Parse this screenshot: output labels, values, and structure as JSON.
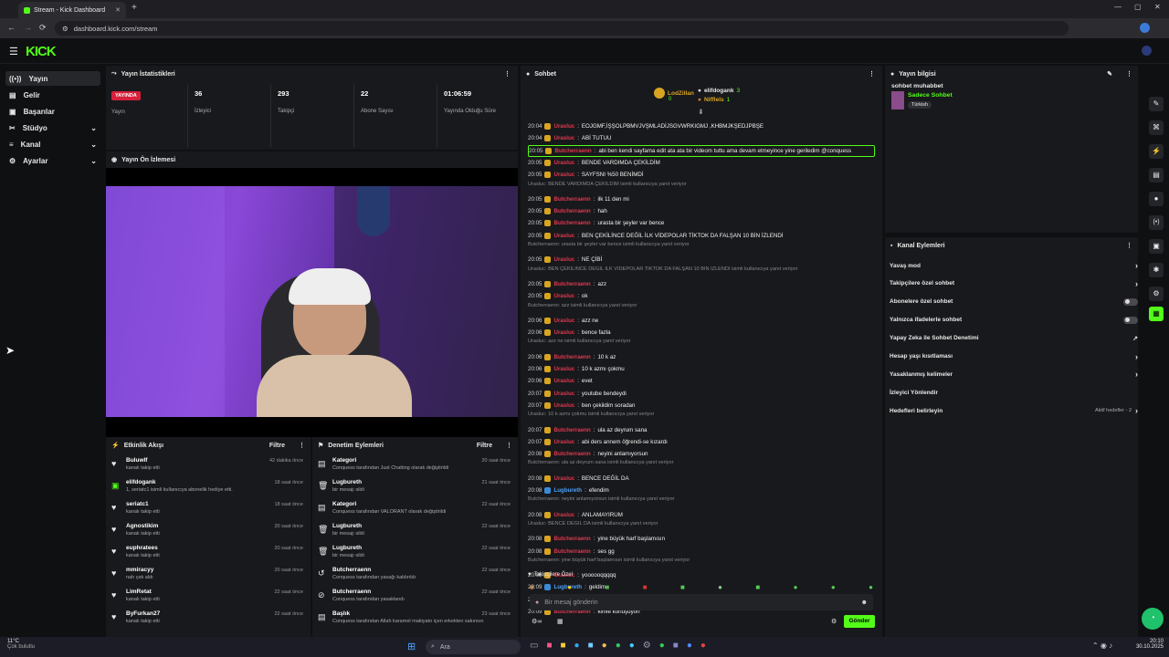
{
  "browser": {
    "tab_title": "Stream - Kick Dashboard",
    "url": "dashboard.kick.com/stream"
  },
  "brand": {
    "logo": "KICK",
    "accent": "#53fc18"
  },
  "sidebar": {
    "items": [
      {
        "label": "Yayın",
        "icon": "broadcast-icon"
      },
      {
        "label": "Gelir",
        "icon": "money-icon"
      },
      {
        "label": "Başarılar",
        "icon": "trophy-icon"
      },
      {
        "label": "Stüdyo",
        "icon": "studio-icon"
      },
      {
        "label": "Kanal",
        "icon": "channel-icon"
      },
      {
        "label": "Ayarlar",
        "icon": "gear-icon"
      }
    ]
  },
  "stats": {
    "title": "Yayın İstatistikleri",
    "live": "YAYINDA",
    "live_label": "Yayın",
    "viewers": "36",
    "viewers_label": "İzleyici",
    "followers": "293",
    "followers_label": "Takipçi",
    "subs": "22",
    "subs_label": "Abone Sayısı",
    "uptime": "01:06:59",
    "uptime_label": "Yayında Olduğu Süre"
  },
  "preview": {
    "title": "Yayın Ön İzlemesi"
  },
  "activity": {
    "title": "Etkinlik Akışı",
    "filter": "Filtre",
    "items": [
      {
        "name": "Buluwlf",
        "text": "kanalı takip etti",
        "time": "42 dakika önce"
      },
      {
        "name": "elifdogank",
        "text": "1, seriatc1 isimli kullanıcıya abonelik hediye etti.",
        "time": "18 saat önce"
      },
      {
        "name": "seriatc1",
        "text": "kanalı takip etti",
        "time": "18 saat önce"
      },
      {
        "name": "Agnostikim",
        "text": "kanalı takip etti",
        "time": "20 saat önce"
      },
      {
        "name": "euphratees",
        "text": "kanalı takip etti",
        "time": "20 saat önce"
      },
      {
        "name": "mmiracyy",
        "text": "nah çek aldı",
        "time": "20 saat önce"
      },
      {
        "name": "LimRetat",
        "text": "kanalı takip etti",
        "time": "22 saat önce"
      },
      {
        "name": "ByFurkan27",
        "text": "kanalı takip etti",
        "time": "22 saat önce"
      }
    ]
  },
  "moderation": {
    "title": "Denetim Eylemleri",
    "filter": "Filtre",
    "items": [
      {
        "name": "Kategori",
        "text": "Conquess tarafından Just Chatting olarak değiştirildi",
        "time": "20 saat önce"
      },
      {
        "name": "Lugbureth",
        "text": "bir mesajı sildi",
        "time": "21 saat önce"
      },
      {
        "name": "Kategori",
        "text": "Conquess tarafından VALORANT olarak değiştirildi",
        "time": "22 saat önce"
      },
      {
        "name": "Lugbureth",
        "text": "bir mesajı sildi",
        "time": "22 saat önce"
      },
      {
        "name": "Lugbureth",
        "text": "bir mesajı sildi",
        "time": "22 saat önce"
      },
      {
        "name": "Butcherraenn",
        "text": "Conquess tarafından yasağı kaldırıldı",
        "time": "22 saat önce"
      },
      {
        "name": "Butcherraenn",
        "text": "Conquess tarafından yasaklandı",
        "time": "22 saat önce"
      },
      {
        "name": "Başlık",
        "text": "Conquess tarafından Allah karamel makiyato içen erkekten sakınsın",
        "time": "23 saat önce"
      }
    ]
  },
  "chat": {
    "title": "Sohbet",
    "top": [
      {
        "name": "LodZillan",
        "count": "0"
      },
      {
        "name": "elifdogank",
        "count": "3"
      },
      {
        "name": "Nifflels",
        "count": "1"
      }
    ],
    "lines": [
      {
        "t": "20:04",
        "u": "Urasluc",
        "m": "EOJGMF,İŞŞOLPBMVJVŞMLADİJSGVWRKIGMJ ,KHBMJKŞEDJPBŞE"
      },
      {
        "t": "20:04",
        "u": "Urasluc",
        "m": "ABİ TUTUU"
      },
      {
        "t": "20:05",
        "u": "Butcherraenn",
        "m": "abi ben kendi sayfama edit ata ata bir videom tuttu ama devam etmeyince yine geriledim @conquess",
        "hl": true
      },
      {
        "t": "20:05",
        "u": "Urasluc",
        "m": "BENDE VARDIMDA ÇEKİLDİM"
      },
      {
        "t": "20:05",
        "u": "Urasluc",
        "m": "SAYFSNI %50 BENİMDİ"
      },
      {
        "reply": "Urasluc: BENDE VARDIMDA ÇEKİLDİM isimli kullanıcıya yanıt veriyor"
      },
      {
        "t": "20:05",
        "u": "Butcherraenn",
        "m": "ilk 11 den mi"
      },
      {
        "t": "20:05",
        "u": "Butcherraenn",
        "m": "hah"
      },
      {
        "t": "20:05",
        "u": "Butcherraenn",
        "m": "urasta bir şeyler var bence"
      },
      {
        "t": "20:05",
        "u": "Urasluc",
        "m": "BEN ÇEKİLİNCE DEĞİL İLK VİDEPOLAR TİKTOK DA FALŞAN 10 BİN İZLENDİ"
      },
      {
        "reply": "Butcherraenn: urasta bir şeyler var bence isimli kullanıcıya yanıt veriyor"
      },
      {
        "t": "20:05",
        "u": "Urasluc",
        "m": "NE ÇİBİ"
      },
      {
        "reply": "Urasluc: BEN ÇEKİLİNCE DEĞİL İLK VİDEPOLAR TİKTOK DA FALŞAN 10 BİN İZLENDİ isimli kullanıcıya yanıt veriyor"
      },
      {
        "t": "20:05",
        "u": "Butcherraenn",
        "m": "azz"
      },
      {
        "t": "20:05",
        "u": "Urasluc",
        "m": "ok"
      },
      {
        "reply": "Butcherraenn: azz isimli kullanıcıya yanıt veriyor"
      },
      {
        "t": "20:06",
        "u": "Urasluc",
        "m": "azz ne"
      },
      {
        "t": "20:06",
        "u": "Urasluc",
        "m": "bence fazla"
      },
      {
        "reply": "Urasluc: azz ne isimli kullanıcıya yanıt veriyor"
      },
      {
        "t": "20:06",
        "u": "Butcherraenn",
        "m": "10 k az"
      },
      {
        "t": "20:06",
        "u": "Urasluc",
        "m": "10 k azmı çokmu"
      },
      {
        "t": "20:06",
        "u": "Urasluc",
        "m": "evet"
      },
      {
        "t": "20:07",
        "u": "Urasluc",
        "m": "youtube bendeydi"
      },
      {
        "t": "20:07",
        "u": "Urasluc",
        "m": "ben çekildim soradan"
      },
      {
        "reply": "Urasluc: 10 k azmı çokmu isimli kullanıcıya yanıt veriyor"
      },
      {
        "t": "20:07",
        "u": "Butcherraenn",
        "m": "ula az deyrum sana"
      },
      {
        "t": "20:07",
        "u": "Urasluc",
        "m": "abi ders annem öğrendi-se kızardı"
      },
      {
        "t": "20:08",
        "u": "Butcherraenn",
        "m": "neyini anlamıyorsun"
      },
      {
        "reply": "Butcherraenn: ula az deyrum sana isimli kullanıcıya yanıt veriyor"
      },
      {
        "t": "20:08",
        "u": "Urasluc",
        "m": "BENCE DEĞİL DA"
      },
      {
        "t": "20:08",
        "u": "Lugbureth",
        "m": "efendim",
        "blue": true
      },
      {
        "reply": "Butcherraenn: neyini anlamıyorsun isimli kullanıcıya yanıt veriyor"
      },
      {
        "t": "20:08",
        "u": "Urasluc",
        "m": "ANLAMAYIRUM"
      },
      {
        "reply": "Urasluc: BENCE DEĞİL DA isimli kullanıcıya yanıt veriyor"
      },
      {
        "t": "20:08",
        "u": "Butcherraenn",
        "m": "yine büyük harf başlamısın"
      },
      {
        "t": "20:08",
        "u": "Butcherraenn",
        "m": "ses gg"
      },
      {
        "reply": "Butcherraenn: yine büyük harf başlamısın isimli kullanıcıya yanıt veriyor"
      },
      {
        "t": "20:08",
        "u": "Urasluc",
        "m": "yoooooqqqqq"
      },
      {
        "t": "20:09",
        "u": "Lugbureth",
        "m": "geldim",
        "blue": true
      },
      {
        "t": "20:09",
        "u": "BotRix",
        "m": "https://www.instagram.com/conquess_/ takip edip beğenirseniz sevinirimssss",
        "bot": true
      },
      {
        "t": "20:09",
        "u": "Butcherraenn",
        "m": "kimle konuşuyon"
      }
    ],
    "followers_only": "Takipçilere Özel",
    "placeholder": "Bir mesaj gönderin",
    "send": "Gönder"
  },
  "info": {
    "title": "Yayın bilgisi",
    "stream_title": "sohbet muhabbet",
    "category": "Sadece Sohbet",
    "language": "Türkish"
  },
  "actions": {
    "title": "Kanal Eylemleri",
    "items": [
      {
        "label": "Yavaş mod",
        "ctrl": "chevron"
      },
      {
        "label": "Takipçilere özel sohbet",
        "ctrl": "chevron"
      },
      {
        "label": "Abonelere özel sohbet",
        "ctrl": "toggle"
      },
      {
        "label": "Yalnızca ifadelerle sohbet",
        "ctrl": "toggle"
      },
      {
        "label": "Yapay Zeka ile Sohbet Denetimi",
        "ctrl": "external"
      },
      {
        "label": "Hesap yaşı kısıtlaması",
        "ctrl": "chevron"
      },
      {
        "label": "Yasaklanmış kelimeler",
        "ctrl": "chevron"
      },
      {
        "label": "İzleyici Yönlendir",
        "ctrl": "none"
      },
      {
        "label": "Hedefleri belirleyin",
        "ctrl": "chevron",
        "extra": "Aktif hedefler - 2"
      }
    ]
  },
  "taskbar": {
    "weather": "11°C",
    "weather_sub": "Çok bulutlu",
    "search": "Ara",
    "time": "20:10",
    "date": "30.10.2025"
  }
}
